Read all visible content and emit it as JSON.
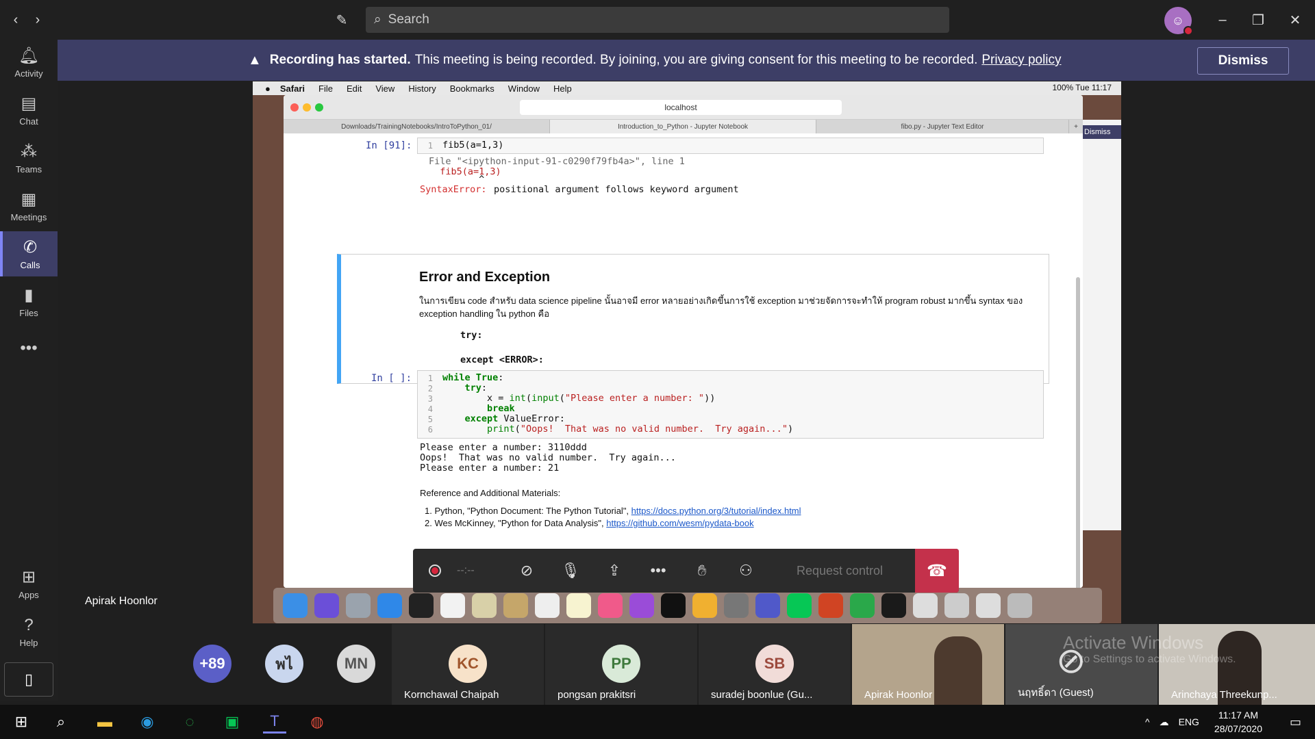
{
  "titlebar": {
    "search_placeholder": "Search"
  },
  "banner": {
    "strong": "Recording has started.",
    "message": "This meeting is being recorded. By joining, you are giving consent for this meeting to be recorded.",
    "link": "Privacy policy",
    "dismiss": "Dismiss"
  },
  "rail": {
    "items": [
      {
        "label": "Activity",
        "icon": "bell-icon"
      },
      {
        "label": "Chat",
        "icon": "chat-icon"
      },
      {
        "label": "Teams",
        "icon": "teams-icon"
      },
      {
        "label": "Meetings",
        "icon": "calendar-icon"
      },
      {
        "label": "Calls",
        "icon": "phone-icon"
      },
      {
        "label": "Files",
        "icon": "file-icon"
      }
    ],
    "apps": "Apps",
    "help": "Help"
  },
  "presenter": "Apirak Hoonlor",
  "mac": {
    "menu": [
      "Safari",
      "File",
      "Edit",
      "View",
      "History",
      "Bookmarks",
      "Window",
      "Help"
    ],
    "status": "100%   Tue 11:17",
    "url": "localhost",
    "tabs": [
      "Downloads/TrainingNotebooks/IntroToPython_01/",
      "Introduction_to_Python - Jupyter Notebook",
      "fibo.py - Jupyter Text Editor"
    ]
  },
  "notebook": {
    "cell1_prompt": "In [91]:",
    "cell1_code": "fib5(a=1,3)",
    "err_file": "File \"<ipython-input-91-c0290f79fb4a>\", line 1",
    "err_line": "  fib5(a=1,3)",
    "err_caret": "         ^",
    "err_type": "SyntaxError:",
    "err_msg": "positional argument follows keyword argument",
    "md_title": "Error and Exception",
    "md_text": "ในการเขียน code สำหรับ data science pipeline นั้นอาจมี error หลายอย่างเกิดขึ้นการใช้ exception มาช่วยจัดการจะทำให้ program robust มากขึ้น syntax ของ exception handling ใน python คือ",
    "md_try": "try:",
    "md_except": "except <ERROR>:",
    "cell2_prompt": "In [ ]:",
    "cell2_output": "Please enter a number: 3110ddd\nOops!  That was no valid number.  Try again...\nPlease enter a number: 21",
    "ref_title": "Reference and Additional Materials:",
    "ref1_text": "1.  Python, \"Python Document: The Python Tutorial\",",
    "ref1_link": "https://docs.python.org/3/tutorial/index.html",
    "ref2_text": "2.  Wes McKinney, \"Python for Data Analysis\",",
    "ref2_link": "https://github.com/wesm/pydata-book"
  },
  "controls": {
    "timer": "--:--",
    "request_control": "Request control"
  },
  "participants": [
    {
      "initials": "+89",
      "color": "#5b5fc7"
    },
    {
      "initials": "พไ",
      "color": "#c9d6ee"
    },
    {
      "initials": "MN",
      "color": "#d9d9d9"
    },
    {
      "initials": "KC",
      "name": "Kornchawal Chaipah",
      "color": "#f7e2c9"
    },
    {
      "initials": "PP",
      "name": "pongsan prakitsri",
      "color": "#d9ead8"
    },
    {
      "initials": "SB",
      "name": "suradej boonlue (Gu...",
      "color": "#f1dcd8"
    },
    {
      "name": "Apirak Hoonlor"
    },
    {
      "name": "นฤทธิ์ดา (Guest)"
    },
    {
      "name": "Arinchaya Threekunp..."
    }
  ],
  "watermark": {
    "title": "Activate Windows",
    "sub": "Go to Settings to activate Windows."
  },
  "taskbar": {
    "lang": "ENG",
    "time": "11:17 AM",
    "date": "28/07/2020"
  }
}
